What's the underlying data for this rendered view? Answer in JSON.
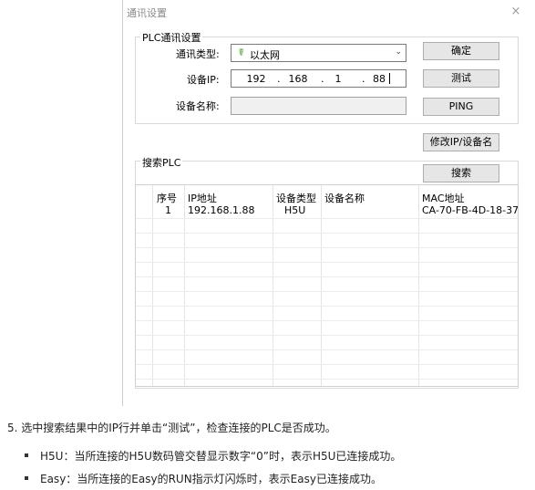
{
  "dialog": {
    "title": "通讯设置",
    "close_glyph": "×",
    "plc_group": {
      "label": "PLC通讯设置",
      "comm_type_label": "通讯类型:",
      "comm_type_value": "以太网",
      "comm_type_icon": "network-icon",
      "device_ip_label": "设备IP:",
      "ip_octets": [
        "192",
        "168",
        "1",
        "88"
      ],
      "device_name_label": "设备名称:",
      "device_name_value": ""
    },
    "buttons": {
      "ok": "确定",
      "test": "测试",
      "ping": "PING",
      "modify": "修改IP/设备名",
      "search": "搜索"
    },
    "search_group": {
      "label": "搜索PLC",
      "columns": [
        "序号",
        "IP地址",
        "设备类型",
        "设备名称",
        "MAC地址"
      ],
      "rows": [
        [
          "1",
          "192.168.1.88",
          "H5U",
          "",
          "CA-70-FB-4D-18-37"
        ]
      ]
    }
  },
  "doc": {
    "step": "5. 选中搜索结果中的IP行并单击“测试”，检查连接的PLC是否成功。",
    "bullets": [
      "H5U：当所连接的H5U数码管交替显示数字“0”时，表示H5U已连接成功。",
      "Easy：当所连接的Easy的RUN指示灯闪烁时，表示Easy已连接成功。"
    ]
  },
  "colors": {
    "button_bg": "#e6e6e6",
    "border": "#d9d9d9",
    "icon_green": "#4f9a31"
  }
}
